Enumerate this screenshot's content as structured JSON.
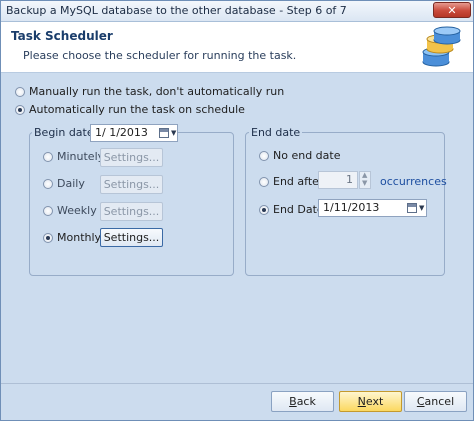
{
  "window": {
    "title": "Backup a MySQL database to the other database - Step 6 of 7",
    "close_glyph": "✕"
  },
  "header": {
    "title": "Task Scheduler",
    "subtitle": "Please choose the scheduler for running the task.",
    "icon": "database-icon"
  },
  "run_mode": {
    "options": [
      {
        "label": "Manually run the task, don't automatically run",
        "checked": false
      },
      {
        "label": "Automatically run the task on schedule",
        "checked": true
      }
    ]
  },
  "begin": {
    "legend": "Begin date",
    "date": "1/  1/2013",
    "frequencies": [
      {
        "label": "Minutely",
        "button": "Settings...",
        "checked": false,
        "enabled": false
      },
      {
        "label": "Daily",
        "button": "Settings...",
        "checked": false,
        "enabled": false
      },
      {
        "label": "Weekly",
        "button": "Settings...",
        "checked": false,
        "enabled": false
      },
      {
        "label": "Monthly",
        "button": "Settings...",
        "checked": true,
        "enabled": true
      }
    ]
  },
  "end": {
    "legend": "End date",
    "no_end_label": "No end date",
    "end_after_label": "End after",
    "occurrences_value": "1",
    "occurrences_label": "occurrences",
    "end_date_label": "End Date",
    "end_date_value": "1/11/2013",
    "selected": "end_date"
  },
  "footer": {
    "back_prefix": "",
    "back_key": "B",
    "back_rest": "ack",
    "next_prefix": "",
    "next_key": "N",
    "next_rest": "ext",
    "cancel_prefix": "",
    "cancel_key": "C",
    "cancel_rest": "ancel"
  }
}
